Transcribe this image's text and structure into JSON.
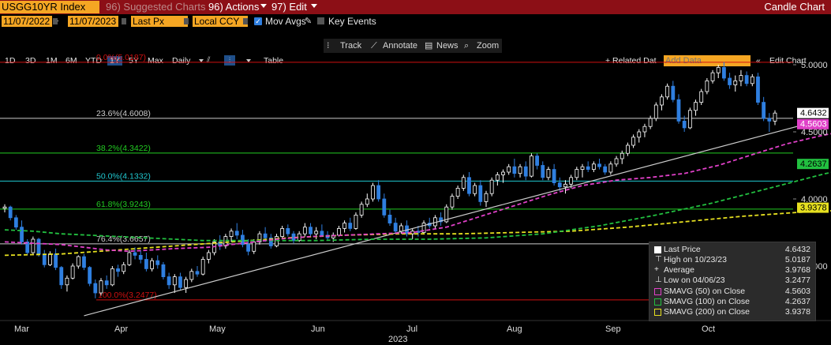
{
  "header": {
    "ticker": "USGG10YR Index",
    "suggested": "96) Suggested Charts",
    "actions": "96) Actions",
    "edit": "97) Edit",
    "title": "Candle Chart"
  },
  "controls": {
    "start_date": "11/07/2022",
    "end_date": "11/07/2023",
    "price_field": "Last Px",
    "currency": "Local CCY",
    "mov_avgs": "Mov Avgs",
    "key_events": "Key Events",
    "range_buttons": [
      "1D",
      "3D",
      "1M",
      "6M",
      "YTD",
      "1Y",
      "5Y",
      "Max"
    ],
    "range_selected": "1Y",
    "frequency": "Daily",
    "table": "Table",
    "related": "+ Related Dat",
    "add_data_placeholder": "Add Data",
    "edit_chart": "Edit Chart"
  },
  "tools": {
    "track": "Track",
    "annotate": "Annotate",
    "news": "News",
    "zoom": "Zoom"
  },
  "colors": {
    "up": "#ffffff",
    "down": "#2f7fe0",
    "sma50": "#e040c8",
    "sma100": "#22c040",
    "sma200": "#e6e020",
    "trendline": "#cccccc",
    "fib_0": "#d01010",
    "fib_236": "#cccccc",
    "fib_382": "#22cc22",
    "fib_50": "#20c8d0",
    "fib_618": "#22cc22",
    "fib_764": "#cccccc",
    "fib_100": "#d01010"
  },
  "chart_data": {
    "type": "candlestick",
    "y_ticks": [
      "5.0000",
      "4.5000",
      "4.0000",
      "3.5000"
    ],
    "x_labels": [
      "Mar",
      "Apr",
      "May",
      "Jun",
      "Jul",
      "Aug",
      "Sep",
      "Oct"
    ],
    "year_label": "2023",
    "fib_levels": [
      {
        "label": "0.0%(5.0187)",
        "value": 5.0187,
        "color": "#d01010"
      },
      {
        "label": "23.6%(4.6008)",
        "value": 4.6008,
        "color": "#cccccc"
      },
      {
        "label": "38.2%(4.3422)",
        "value": 4.3422,
        "color": "#22cc22"
      },
      {
        "label": "50.0%(4.1332)",
        "value": 4.1332,
        "color": "#20c8d0"
      },
      {
        "label": "61.8%(3.9243)",
        "value": 3.9243,
        "color": "#22cc22"
      },
      {
        "label": "76.4%(3.6657)",
        "value": 3.6657,
        "color": "#cccccc"
      },
      {
        "label": "100.0%(3.2477)",
        "value": 3.2477,
        "color": "#d01010"
      }
    ],
    "last_price_tags": [
      {
        "value": 4.6432,
        "label": "4.6432",
        "bg": "#ffffff",
        "fg": "#000000"
      },
      {
        "value": 4.5603,
        "label": "4.5603",
        "bg": "#e040c8",
        "fg": "#ffffff"
      },
      {
        "value": 4.2637,
        "label": "4.2637",
        "bg": "#22c040",
        "fg": "#000000"
      },
      {
        "value": 3.9378,
        "label": "3.9378",
        "bg": "#e6e020",
        "fg": "#000000"
      }
    ],
    "sma50_path": [
      [
        0,
        3.68
      ],
      [
        5,
        3.67
      ],
      [
        10,
        3.66
      ],
      [
        14,
        3.64
      ],
      [
        18,
        3.62
      ],
      [
        22,
        3.61
      ],
      [
        26,
        3.62
      ],
      [
        30,
        3.63
      ],
      [
        36,
        3.64
      ],
      [
        42,
        3.67
      ],
      [
        48,
        3.7
      ],
      [
        54,
        3.72
      ],
      [
        60,
        3.73
      ],
      [
        66,
        3.74
      ],
      [
        72,
        3.75
      ],
      [
        78,
        3.79
      ],
      [
        84,
        3.87
      ],
      [
        90,
        3.95
      ],
      [
        96,
        4.03
      ],
      [
        102,
        4.1
      ],
      [
        108,
        4.14
      ],
      [
        114,
        4.16
      ],
      [
        120,
        4.19
      ],
      [
        126,
        4.25
      ],
      [
        132,
        4.33
      ],
      [
        138,
        4.41
      ],
      [
        144,
        4.47
      ],
      [
        150,
        4.52
      ],
      [
        155,
        4.56
      ]
    ],
    "sma100_path": [
      [
        0,
        3.77
      ],
      [
        5,
        3.76
      ],
      [
        10,
        3.74
      ],
      [
        15,
        3.73
      ],
      [
        20,
        3.72
      ],
      [
        25,
        3.71
      ],
      [
        30,
        3.7
      ],
      [
        35,
        3.69
      ],
      [
        45,
        3.69
      ],
      [
        55,
        3.69
      ],
      [
        65,
        3.7
      ],
      [
        75,
        3.7
      ],
      [
        85,
        3.71
      ],
      [
        95,
        3.74
      ],
      [
        105,
        3.8
      ],
      [
        115,
        3.88
      ],
      [
        125,
        3.97
      ],
      [
        135,
        4.08
      ],
      [
        145,
        4.19
      ],
      [
        155,
        4.26
      ]
    ],
    "sma200_path": [
      [
        0,
        3.58
      ],
      [
        10,
        3.59
      ],
      [
        20,
        3.62
      ],
      [
        30,
        3.65
      ],
      [
        40,
        3.68
      ],
      [
        50,
        3.71
      ],
      [
        60,
        3.73
      ],
      [
        70,
        3.74
      ],
      [
        80,
        3.74
      ],
      [
        90,
        3.75
      ],
      [
        100,
        3.76
      ],
      [
        110,
        3.79
      ],
      [
        120,
        3.83
      ],
      [
        130,
        3.87
      ],
      [
        140,
        3.9
      ],
      [
        150,
        3.92
      ],
      [
        155,
        3.94
      ]
    ],
    "trendline": [
      [
        14,
        3.13
      ],
      [
        155,
        4.52
      ]
    ],
    "candles": [
      [
        3.93,
        3.96,
        3.9,
        3.94
      ],
      [
        3.94,
        3.95,
        3.84,
        3.86
      ],
      [
        3.86,
        3.88,
        3.77,
        3.79
      ],
      [
        3.79,
        3.84,
        3.66,
        3.68
      ],
      [
        3.68,
        3.7,
        3.58,
        3.6
      ],
      [
        3.6,
        3.72,
        3.59,
        3.7
      ],
      [
        3.7,
        3.71,
        3.57,
        3.59
      ],
      [
        3.59,
        3.62,
        3.49,
        3.51
      ],
      [
        3.51,
        3.61,
        3.5,
        3.59
      ],
      [
        3.59,
        3.63,
        3.47,
        3.49
      ],
      [
        3.49,
        3.5,
        3.33,
        3.36
      ],
      [
        3.36,
        3.43,
        3.31,
        3.41
      ],
      [
        3.41,
        3.52,
        3.4,
        3.5
      ],
      [
        3.5,
        3.58,
        3.48,
        3.57
      ],
      [
        3.57,
        3.59,
        3.47,
        3.49
      ],
      [
        3.49,
        3.5,
        3.35,
        3.37
      ],
      [
        3.37,
        3.4,
        3.26,
        3.3
      ],
      [
        3.3,
        3.41,
        3.28,
        3.39
      ],
      [
        3.39,
        3.43,
        3.33,
        3.36
      ],
      [
        3.36,
        3.5,
        3.35,
        3.48
      ],
      [
        3.48,
        3.51,
        3.42,
        3.46
      ],
      [
        3.46,
        3.53,
        3.44,
        3.51
      ],
      [
        3.51,
        3.62,
        3.5,
        3.6
      ],
      [
        3.6,
        3.64,
        3.55,
        3.58
      ],
      [
        3.58,
        3.62,
        3.52,
        3.55
      ],
      [
        3.55,
        3.6,
        3.46,
        3.48
      ],
      [
        3.48,
        3.56,
        3.46,
        3.54
      ],
      [
        3.54,
        3.58,
        3.48,
        3.51
      ],
      [
        3.51,
        3.53,
        3.4,
        3.42
      ],
      [
        3.42,
        3.45,
        3.33,
        3.36
      ],
      [
        3.36,
        3.44,
        3.3,
        3.42
      ],
      [
        3.42,
        3.45,
        3.32,
        3.34
      ],
      [
        3.34,
        3.42,
        3.3,
        3.4
      ],
      [
        3.4,
        3.48,
        3.38,
        3.46
      ],
      [
        3.46,
        3.5,
        3.42,
        3.44
      ],
      [
        3.44,
        3.57,
        3.43,
        3.55
      ],
      [
        3.55,
        3.62,
        3.52,
        3.6
      ],
      [
        3.6,
        3.7,
        3.58,
        3.68
      ],
      [
        3.68,
        3.73,
        3.62,
        3.65
      ],
      [
        3.65,
        3.74,
        3.63,
        3.72
      ],
      [
        3.72,
        3.78,
        3.68,
        3.76
      ],
      [
        3.76,
        3.82,
        3.7,
        3.73
      ],
      [
        3.73,
        3.77,
        3.64,
        3.66
      ],
      [
        3.66,
        3.7,
        3.58,
        3.61
      ],
      [
        3.61,
        3.7,
        3.59,
        3.68
      ],
      [
        3.68,
        3.76,
        3.66,
        3.74
      ],
      [
        3.74,
        3.79,
        3.68,
        3.71
      ],
      [
        3.71,
        3.74,
        3.63,
        3.65
      ],
      [
        3.65,
        3.74,
        3.64,
        3.72
      ],
      [
        3.72,
        3.8,
        3.7,
        3.78
      ],
      [
        3.78,
        3.81,
        3.72,
        3.74
      ],
      [
        3.74,
        3.76,
        3.67,
        3.69
      ],
      [
        3.69,
        3.76,
        3.68,
        3.74
      ],
      [
        3.74,
        3.82,
        3.72,
        3.79
      ],
      [
        3.79,
        3.82,
        3.72,
        3.74
      ],
      [
        3.74,
        3.79,
        3.7,
        3.76
      ],
      [
        3.76,
        3.81,
        3.72,
        3.73
      ],
      [
        3.73,
        3.76,
        3.69,
        3.71
      ],
      [
        3.71,
        3.75,
        3.68,
        3.73
      ],
      [
        3.73,
        3.8,
        3.72,
        3.78
      ],
      [
        3.78,
        3.84,
        3.75,
        3.82
      ],
      [
        3.82,
        3.86,
        3.76,
        3.78
      ],
      [
        3.78,
        3.9,
        3.77,
        3.88
      ],
      [
        3.88,
        3.98,
        3.86,
        3.96
      ],
      [
        3.96,
        4.04,
        3.94,
        4.0
      ],
      [
        4.0,
        4.12,
        3.98,
        4.1
      ],
      [
        4.1,
        4.14,
        3.98,
        4.0
      ],
      [
        4.0,
        4.04,
        3.86,
        3.88
      ],
      [
        3.88,
        3.92,
        3.8,
        3.82
      ],
      [
        3.82,
        3.86,
        3.74,
        3.76
      ],
      [
        3.76,
        3.82,
        3.74,
        3.8
      ],
      [
        3.8,
        3.84,
        3.72,
        3.74
      ],
      [
        3.74,
        3.78,
        3.7,
        3.76
      ],
      [
        3.76,
        3.8,
        3.72,
        3.75
      ],
      [
        3.75,
        3.84,
        3.74,
        3.82
      ],
      [
        3.82,
        3.86,
        3.78,
        3.8
      ],
      [
        3.8,
        3.88,
        3.78,
        3.86
      ],
      [
        3.86,
        3.9,
        3.8,
        3.83
      ],
      [
        3.83,
        3.96,
        3.82,
        3.94
      ],
      [
        3.94,
        4.04,
        3.92,
        4.02
      ],
      [
        4.02,
        4.1,
        4.0,
        4.08
      ],
      [
        4.08,
        4.18,
        4.06,
        4.16
      ],
      [
        4.16,
        4.2,
        4.02,
        4.04
      ],
      [
        4.04,
        4.12,
        4.02,
        4.1
      ],
      [
        4.1,
        4.14,
        3.95,
        3.98
      ],
      [
        3.98,
        4.06,
        3.94,
        4.04
      ],
      [
        4.04,
        4.16,
        4.02,
        4.14
      ],
      [
        4.14,
        4.2,
        4.1,
        4.18
      ],
      [
        4.18,
        4.22,
        4.12,
        4.2
      ],
      [
        4.2,
        4.26,
        4.18,
        4.24
      ],
      [
        4.24,
        4.3,
        4.16,
        4.19
      ],
      [
        4.19,
        4.26,
        4.16,
        4.24
      ],
      [
        4.24,
        4.28,
        4.14,
        4.17
      ],
      [
        4.17,
        4.34,
        4.16,
        4.32
      ],
      [
        4.32,
        4.34,
        4.22,
        4.25
      ],
      [
        4.25,
        4.28,
        4.14,
        4.16
      ],
      [
        4.16,
        4.24,
        4.14,
        4.22
      ],
      [
        4.22,
        4.26,
        4.1,
        4.12
      ],
      [
        4.12,
        4.16,
        4.06,
        4.09
      ],
      [
        4.09,
        4.14,
        4.04,
        4.11
      ],
      [
        4.11,
        4.18,
        4.08,
        4.16
      ],
      [
        4.16,
        4.24,
        4.14,
        4.22
      ],
      [
        4.22,
        4.26,
        4.16,
        4.24
      ],
      [
        4.24,
        4.28,
        4.2,
        4.22
      ],
      [
        4.22,
        4.28,
        4.2,
        4.26
      ],
      [
        4.26,
        4.3,
        4.22,
        4.24
      ],
      [
        4.24,
        4.26,
        4.18,
        4.2
      ],
      [
        4.2,
        4.28,
        4.18,
        4.26
      ],
      [
        4.26,
        4.32,
        4.24,
        4.3
      ],
      [
        4.3,
        4.36,
        4.26,
        4.34
      ],
      [
        4.34,
        4.42,
        4.32,
        4.4
      ],
      [
        4.4,
        4.48,
        4.38,
        4.46
      ],
      [
        4.46,
        4.52,
        4.42,
        4.5
      ],
      [
        4.5,
        4.56,
        4.46,
        4.54
      ],
      [
        4.54,
        4.62,
        4.52,
        4.6
      ],
      [
        4.6,
        4.72,
        4.58,
        4.7
      ],
      [
        4.7,
        4.78,
        4.66,
        4.76
      ],
      [
        4.76,
        4.86,
        4.74,
        4.84
      ],
      [
        4.84,
        4.88,
        4.72,
        4.74
      ],
      [
        4.74,
        4.78,
        4.56,
        4.58
      ],
      [
        4.58,
        4.62,
        4.5,
        4.53
      ],
      [
        4.53,
        4.68,
        4.52,
        4.66
      ],
      [
        4.66,
        4.74,
        4.62,
        4.72
      ],
      [
        4.72,
        4.82,
        4.7,
        4.8
      ],
      [
        4.8,
        4.9,
        4.78,
        4.88
      ],
      [
        4.88,
        4.96,
        4.86,
        4.94
      ],
      [
        4.94,
        5.0,
        4.9,
        4.98
      ],
      [
        4.98,
        5.02,
        4.88,
        4.9
      ],
      [
        4.9,
        4.94,
        4.82,
        4.85
      ],
      [
        4.85,
        4.92,
        4.8,
        4.88
      ],
      [
        4.88,
        4.96,
        4.84,
        4.92
      ],
      [
        4.92,
        4.95,
        4.84,
        4.86
      ],
      [
        4.86,
        4.93,
        4.84,
        4.91
      ],
      [
        4.91,
        4.94,
        4.7,
        4.72
      ],
      [
        4.72,
        4.76,
        4.58,
        4.6
      ],
      [
        4.6,
        4.64,
        4.5,
        4.58
      ],
      [
        4.58,
        4.66,
        4.55,
        4.64
      ]
    ]
  },
  "legend": {
    "rows": [
      {
        "label": "Last Price",
        "value": "4.6432"
      },
      {
        "label": "High on 10/23/23",
        "value": "5.0187"
      },
      {
        "label": "Average",
        "value": "3.9768"
      },
      {
        "label": "Low on 04/06/23",
        "value": "3.2477"
      },
      {
        "label": "SMAVG (50)  on Close",
        "value": "4.5603"
      },
      {
        "label": "SMAVG (100)  on Close",
        "value": "4.2637"
      },
      {
        "label": "SMAVG (200)  on Close",
        "value": "3.9378"
      }
    ]
  }
}
